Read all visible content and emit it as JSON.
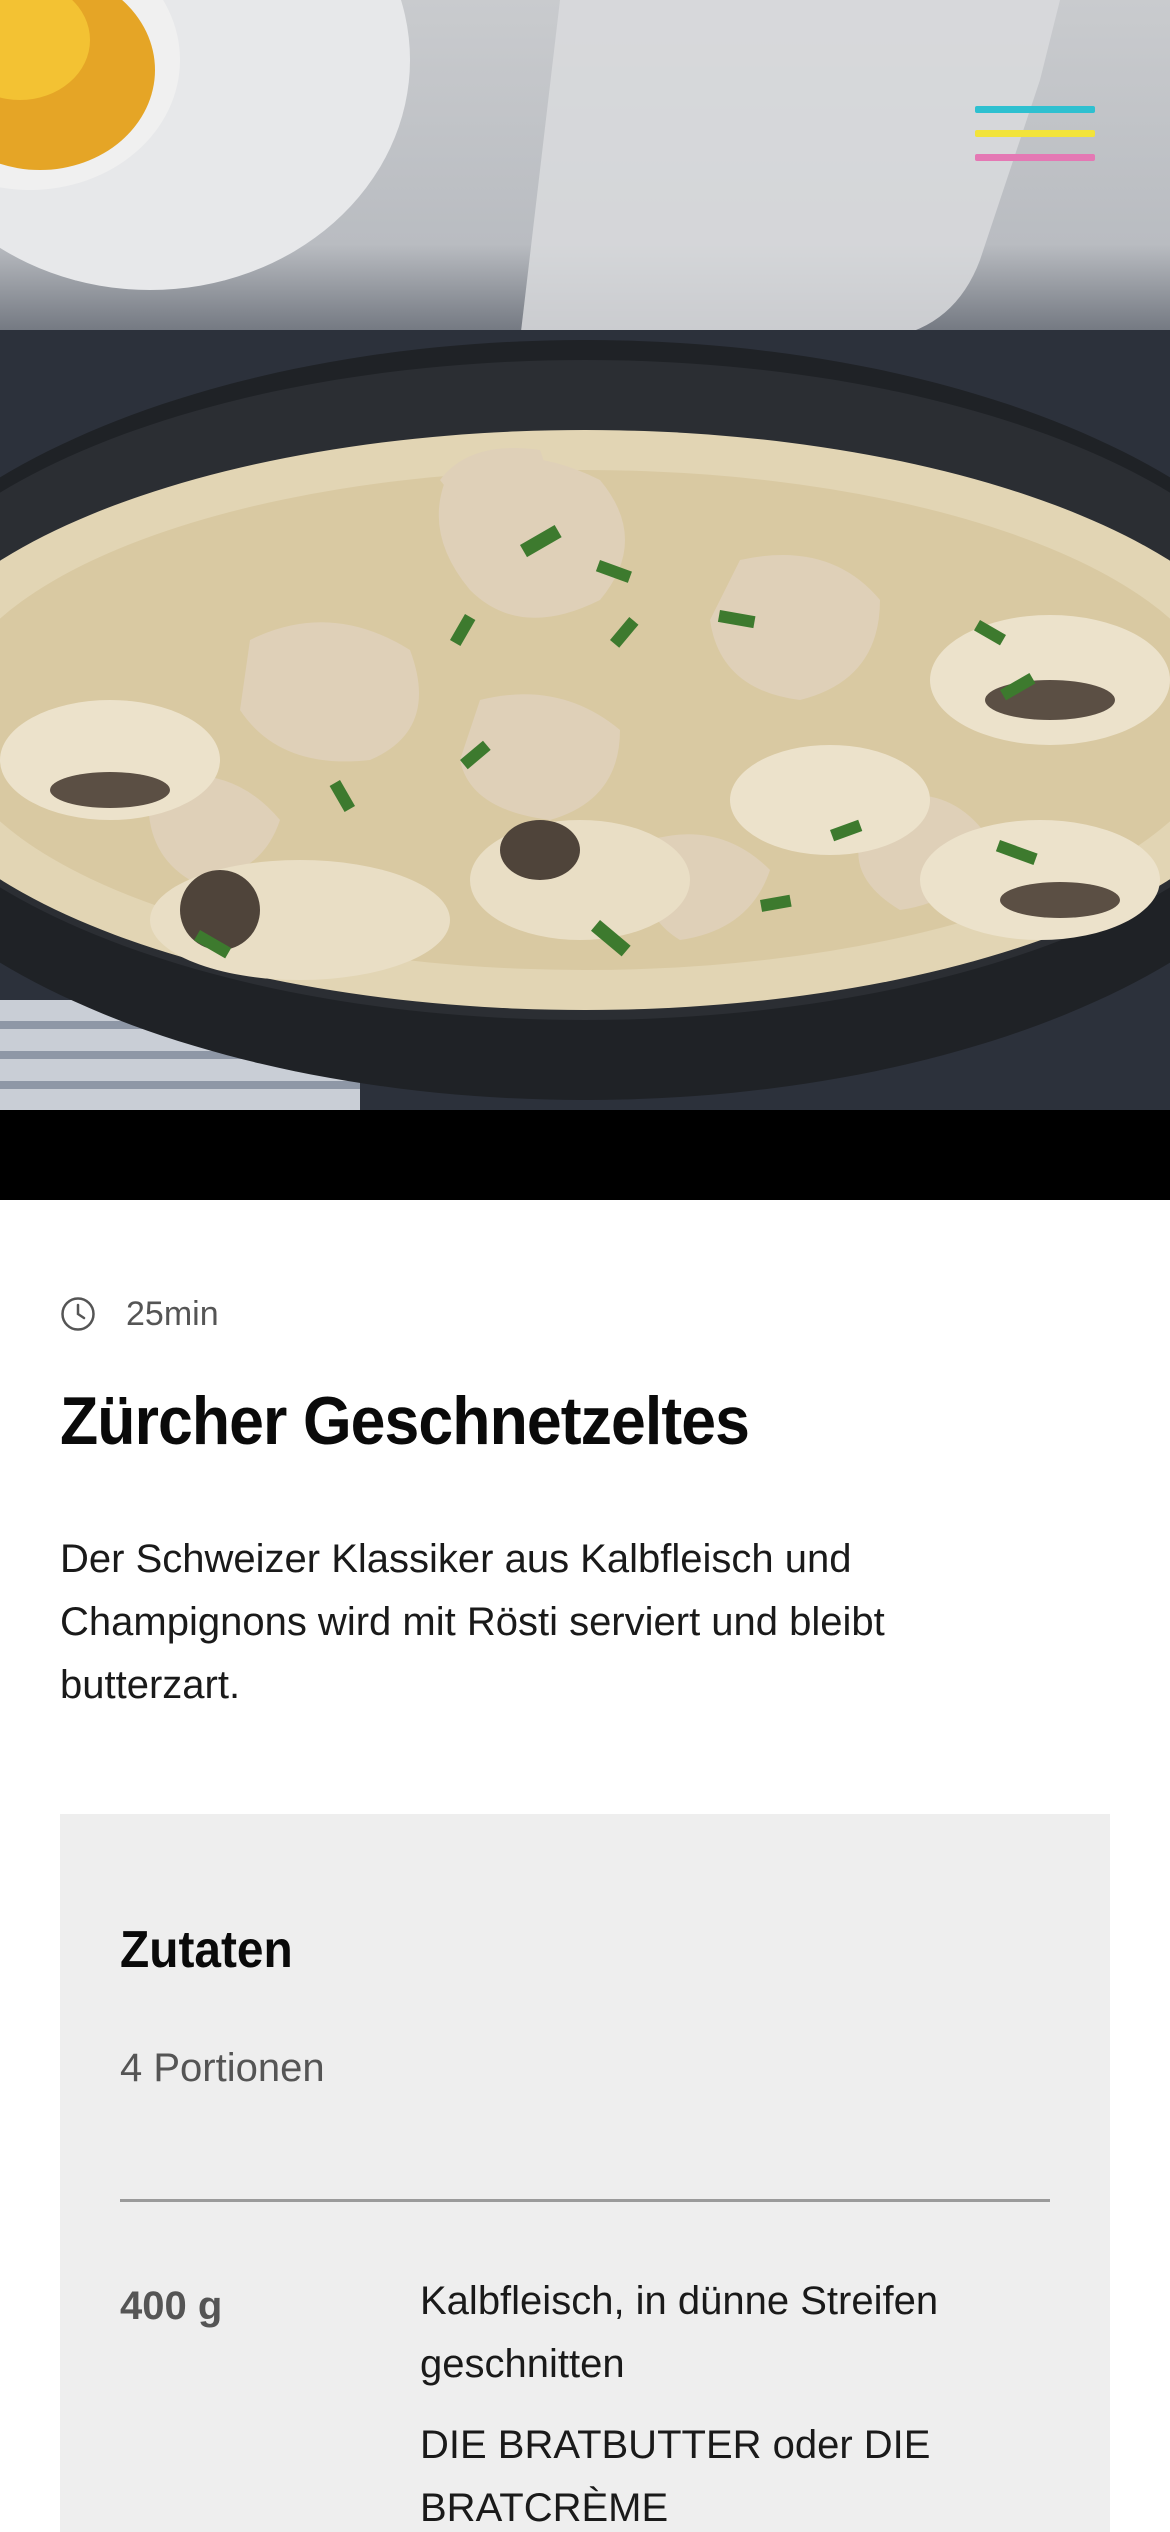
{
  "hero": {
    "image_description": "creamy veal and mushroom stew in a dark pan",
    "menu_icon": "hamburger-menu-icon",
    "menu_colors": [
      "#2ec0d0",
      "#f2e33a",
      "#e478b4"
    ]
  },
  "recipe": {
    "time_icon": "clock-icon",
    "time": "25min",
    "title": "Zürcher Geschnetzeltes",
    "description": "Der Schweizer Klassiker aus Kalbfleisch und Champignons wird mit Rösti serviert und bleibt butterzart."
  },
  "ingredients": {
    "heading": "Zutaten",
    "portions": "4 Portionen",
    "items": [
      {
        "quantity": "400 g",
        "name": "Kalbfleisch, in dünne Streifen geschnitten",
        "note": "DIE BRATBUTTER oder DIE BRATCRÈME"
      }
    ]
  }
}
